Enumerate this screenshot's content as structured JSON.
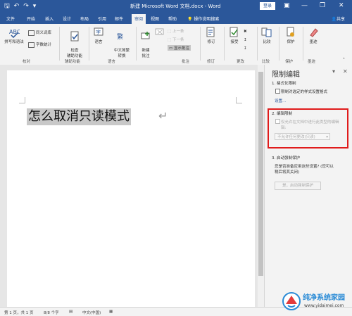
{
  "titlebar": {
    "title": "新建 Microsoft Word 文档.docx - Word",
    "login": "登录",
    "minimize": "—",
    "restore": "❐",
    "close": "✕"
  },
  "tabs": [
    "文件",
    "开始",
    "插入",
    "设计",
    "布局",
    "引用",
    "邮件",
    "审阅",
    "视图",
    "帮助",
    "操作说明搜索"
  ],
  "active_tab": "审阅",
  "share": "共享",
  "ribbon": {
    "spelling": "拼写和语法",
    "thesaurus": "同义词库",
    "wordcount": "字数统计",
    "check_access": "检查\n辅助功能",
    "language": "语言",
    "chinese_conv": "中文简繁\n转换",
    "new_comment": "新建\n批注",
    "prev": "上一条",
    "next": "下一条",
    "show_comments": "显示批注",
    "track": "修订",
    "accept": "接受",
    "compare": "比较",
    "protect": "保护",
    "ink": "墨迹",
    "groups": [
      "校对",
      "辅助功能",
      "语言",
      "批注",
      "修订",
      "更改",
      "比较",
      "保护",
      "墨迹"
    ]
  },
  "document": {
    "text": "怎么取消只读模式",
    "para_mark": "↵"
  },
  "pane": {
    "title": "限制编辑",
    "s1": "1. 格式化限制",
    "s1_check": "限制对选定的样式设置格式",
    "settings": "设置...",
    "s2": "2. 编辑限制",
    "s2_check": "仅允许在文档中进行此类型的编辑",
    "s2_check2": "辑:",
    "s2_select": "不允许任何更改(只读)",
    "s3": "3. 启动强制保护",
    "s3_q1": "您是否准备应用这些设置? (您可以",
    "s3_q2": "稍后将其关闭)",
    "s3_btn": "是，启动强制保护"
  },
  "status": {
    "page": "第 1 页，共 1 页",
    "words": "8/8 个字",
    "lang": "中文(中国)"
  },
  "watermark": {
    "name": "纯净系统家园",
    "url": "www.yidaimei.com"
  }
}
